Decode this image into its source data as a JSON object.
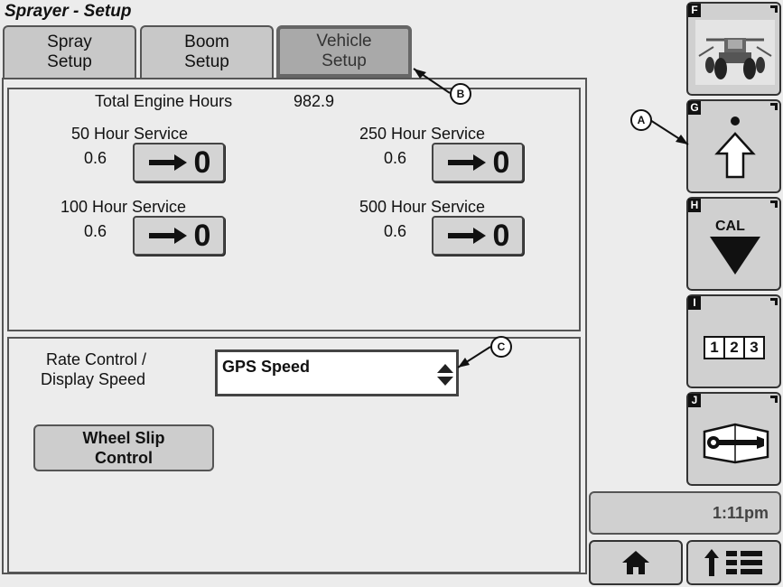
{
  "header": {
    "title": "Sprayer - Setup"
  },
  "tabs": [
    {
      "label": "Spray\nSetup"
    },
    {
      "label": "Boom\nSetup"
    },
    {
      "label": "Vehicle\nSetup"
    }
  ],
  "engine": {
    "label": "Total Engine Hours",
    "value": "982.9"
  },
  "services": [
    {
      "label": "50 Hour Service",
      "value": "0.6",
      "reset": "0"
    },
    {
      "label": "250 Hour Service",
      "value": "0.6",
      "reset": "0"
    },
    {
      "label": "100 Hour Service",
      "value": "0.6",
      "reset": "0"
    },
    {
      "label": "500 Hour Service",
      "value": "0.6",
      "reset": "0"
    }
  ],
  "rate_control": {
    "label_line1": "Rate Control /",
    "label_line2": "Display Speed",
    "selected": "GPS Speed"
  },
  "wheel_slip": {
    "label": "Wheel Slip\nControl"
  },
  "side_buttons": [
    {
      "letter": "F",
      "icon": "sprayer-vehicle-icon"
    },
    {
      "letter": "G",
      "icon": "shift-up-arrow-icon"
    },
    {
      "letter": "H",
      "icon": "cal-down-arrow-icon",
      "text": "CAL"
    },
    {
      "letter": "I",
      "icon": "numbered-boxes-icon",
      "digits": [
        "1",
        "2",
        "3"
      ]
    },
    {
      "letter": "J",
      "icon": "wrench-manual-icon"
    }
  ],
  "clock": {
    "time": "1:11pm"
  },
  "callouts": {
    "a": "A",
    "b": "B",
    "c": "C"
  },
  "bottom_buttons": [
    {
      "icon": "home-icon"
    },
    {
      "icon": "up-arrow-menu-icon"
    }
  ]
}
